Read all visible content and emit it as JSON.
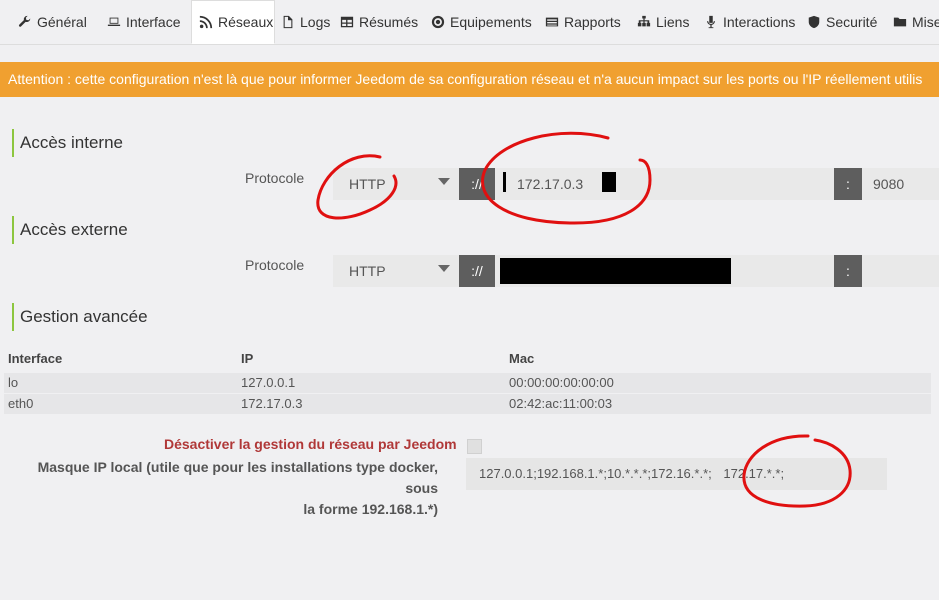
{
  "tabs": [
    {
      "label": "Général",
      "icon": "wrench-icon"
    },
    {
      "label": "Interface",
      "icon": "laptop-icon"
    },
    {
      "label": "Réseaux",
      "icon": "rss-icon"
    },
    {
      "label": "Logs",
      "icon": "file-icon"
    },
    {
      "label": "Résumés",
      "icon": "table-icon"
    },
    {
      "label": "Equipements",
      "icon": "eye-icon"
    },
    {
      "label": "Rapports",
      "icon": "list-icon"
    },
    {
      "label": "Liens",
      "icon": "sitemap-icon"
    },
    {
      "label": "Interactions",
      "icon": "microphone-icon"
    },
    {
      "label": "Securité",
      "icon": "shield-icon"
    },
    {
      "label": "Mise",
      "icon": "folder-icon"
    }
  ],
  "alert": "Attention : cette configuration n'est là que pour informer Jeedom de sa configuration réseau et n'a aucun impact sur les ports ou l'IP réellement utilis",
  "internal": {
    "title": "Accès interne",
    "protocol_label": "Protocole",
    "protocol": "HTTP",
    "separator": "://",
    "host": "172.17.0.3",
    "port_separator": ":",
    "port": "9080"
  },
  "external": {
    "title": "Accès externe",
    "protocol_label": "Protocole",
    "protocol": "HTTP",
    "separator": "://",
    "port_separator": ":"
  },
  "advanced": {
    "title": "Gestion avancée",
    "headers": [
      "Interface",
      "IP",
      "Mac"
    ],
    "rows": [
      {
        "interface": "lo",
        "ip": "127.0.0.1",
        "mac": "00:00:00:00:00:00"
      },
      {
        "interface": "eth0",
        "ip": "172.17.0.3",
        "mac": "02:42:ac:11:00:03"
      }
    ],
    "disable_label": "Désactiver la gestion du réseau par Jeedom",
    "mask_label_line1": "Masque IP local (utile que pour les installations type docker, sous",
    "mask_label_line2": "la forme 192.168.1.*)",
    "mask_value": "127.0.0.1;192.168.1.*;10.*.*.*;172.16.*.*;",
    "mask_extra": "172.17.*.*;"
  },
  "colors": {
    "accent": "#8dc63f",
    "alert": "#f0a030",
    "danger": "#b03838",
    "annotation": "#e01010"
  }
}
